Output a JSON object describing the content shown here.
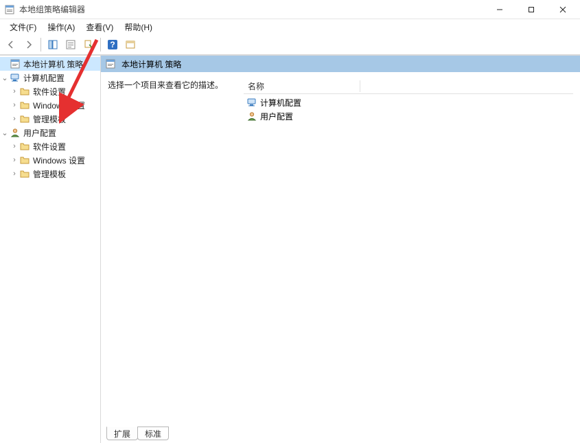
{
  "title": "本地组策略编辑器",
  "menu": {
    "file": "文件(F)",
    "action": "操作(A)",
    "view": "查看(V)",
    "help": "帮助(H)"
  },
  "tree": {
    "root": "本地计算机 策略",
    "computer_config": "计算机配置",
    "user_config": "用户配置",
    "software_settings": "软件设置",
    "windows_settings": "Windows 设置",
    "admin_templates": "管理模板"
  },
  "details": {
    "header": "本地计算机 策略",
    "prompt": "选择一个项目来查看它的描述。",
    "col_name": "名称",
    "item_computer": "计算机配置",
    "item_user": "用户配置"
  },
  "tabs": {
    "extended": "扩展",
    "standard": "标准"
  }
}
